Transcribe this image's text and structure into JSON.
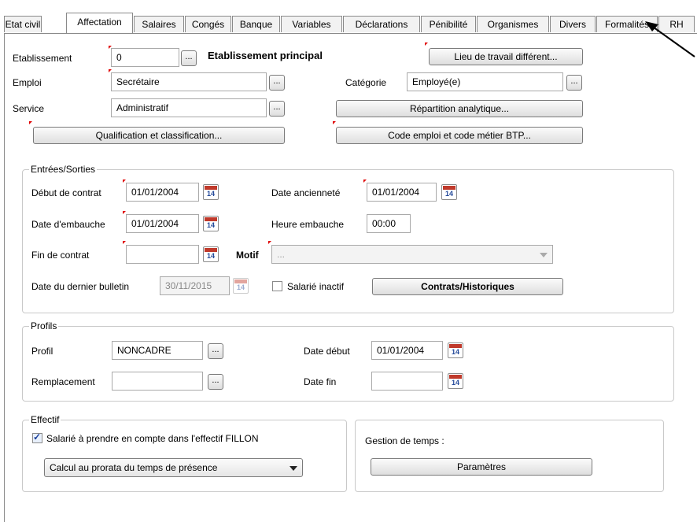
{
  "tabs": [
    {
      "label": "Etat civil"
    },
    {
      "label": "Affectation"
    },
    {
      "label": "Salaires"
    },
    {
      "label": "Congés"
    },
    {
      "label": "Banque"
    },
    {
      "label": "Variables"
    },
    {
      "label": "Déclarations"
    },
    {
      "label": "Pénibilité"
    },
    {
      "label": "Organismes"
    },
    {
      "label": "Divers"
    },
    {
      "label": "Formalités"
    },
    {
      "label": "RH"
    }
  ],
  "active_tab": "Affectation",
  "affectation": {
    "etablissement_label": "Etablissement",
    "etablissement_value": "0",
    "etablissement_name": "Etablissement principal",
    "lieu_travail_button": "Lieu de travail différent...",
    "emploi_label": "Emploi",
    "emploi_value": "Secrétaire",
    "categorie_label": "Catégorie",
    "categorie_value": "Employé(e)",
    "service_label": "Service",
    "service_value": "Administratif",
    "repartition_button": "Répartition analytique...",
    "qualification_button": "Qualification et classification...",
    "code_emploi_button": "Code emploi et code métier BTP...",
    "ellipsis": "..."
  },
  "entrees_sorties": {
    "title": "Entrées/Sorties",
    "debut_contrat_label": "Début de contrat",
    "debut_contrat_value": "01/01/2004",
    "date_anciennete_label": "Date ancienneté",
    "date_anciennete_value": "01/01/2004",
    "date_embauche_label": "Date d'embauche",
    "date_embauche_value": "01/01/2004",
    "heure_embauche_label": "Heure embauche",
    "heure_embauche_value": "00:00",
    "fin_contrat_label": "Fin de contrat",
    "fin_contrat_value": "",
    "motif_label": "Motif",
    "motif_value": "...",
    "dernier_bulletin_label": "Date du dernier bulletin",
    "dernier_bulletin_value": "30/11/2015",
    "salarie_inactif_label": "Salarié inactif",
    "salarie_inactif_checked": false,
    "contrats_button": "Contrats/Historiques",
    "calendar_day": "14"
  },
  "profils": {
    "title": "Profils",
    "profil_label": "Profil",
    "profil_value": "NONCADRE",
    "date_debut_label": "Date début",
    "date_debut_value": "01/01/2004",
    "remplacement_label": "Remplacement",
    "remplacement_value": "",
    "date_fin_label": "Date fin",
    "date_fin_value": ""
  },
  "effectif": {
    "title": "Effectif",
    "fillon_label": "Salarié à prendre en compte dans l'effectif FILLON",
    "fillon_checked": true,
    "calcul_selected": "Calcul au prorata du temps de présence"
  },
  "gestion_temps": {
    "label": "Gestion de temps :",
    "parametres_button": "Paramètres"
  }
}
